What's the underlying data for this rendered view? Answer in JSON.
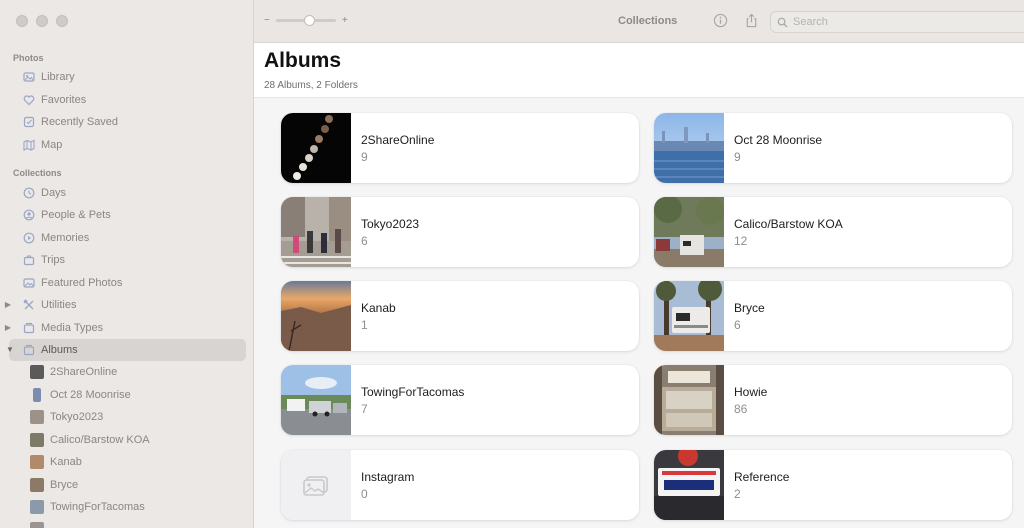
{
  "sidebar": {
    "photos_section": "Photos",
    "photos_items": [
      {
        "label": "Library",
        "icon": "library-icon"
      },
      {
        "label": "Favorites",
        "icon": "heart-icon"
      },
      {
        "label": "Recently Saved",
        "icon": "recently-saved-icon"
      },
      {
        "label": "Map",
        "icon": "map-icon"
      }
    ],
    "collections_section": "Collections",
    "collections_items": [
      {
        "label": "Days",
        "icon": "clock-icon"
      },
      {
        "label": "People & Pets",
        "icon": "person-icon"
      },
      {
        "label": "Memories",
        "icon": "memories-icon"
      },
      {
        "label": "Trips",
        "icon": "suitcase-icon"
      },
      {
        "label": "Featured Photos",
        "icon": "photo-icon"
      },
      {
        "label": "Utilities",
        "icon": "utilities-icon"
      },
      {
        "label": "Media Types",
        "icon": "media-types-icon"
      },
      {
        "label": "Albums",
        "icon": "album-icon"
      }
    ],
    "album_items": [
      {
        "label": "2ShareOnline"
      },
      {
        "label": "Oct 28 Moonrise"
      },
      {
        "label": "Tokyo2023"
      },
      {
        "label": "Calico/Barstow KOA"
      },
      {
        "label": "Kanab"
      },
      {
        "label": "Bryce"
      },
      {
        "label": "TowingForTacomas"
      }
    ]
  },
  "toolbar": {
    "title": "Collections",
    "zoom_minus": "−",
    "zoom_plus": "+",
    "search_placeholder": "Search"
  },
  "main": {
    "title": "Albums",
    "subtitle": "28 Albums, 2 Folders",
    "albums": [
      {
        "name": "2ShareOnline",
        "count": "9"
      },
      {
        "name": "Oct 28 Moonrise",
        "count": "9"
      },
      {
        "name": "Tokyo2023",
        "count": "6"
      },
      {
        "name": "Calico/Barstow KOA",
        "count": "12"
      },
      {
        "name": "Kanab",
        "count": "1"
      },
      {
        "name": "Bryce",
        "count": "6"
      },
      {
        "name": "TowingForTacomas",
        "count": "7"
      },
      {
        "name": "Howie",
        "count": "86"
      },
      {
        "name": "Instagram",
        "count": "0"
      },
      {
        "name": "Reference",
        "count": "2"
      }
    ]
  },
  "colors": {
    "sidebar_bg": "#ebe8e5",
    "selected_bg": "#d8d4d1",
    "main_bg": "#f5f5f6",
    "icon_blue": "#9aa6c8"
  }
}
